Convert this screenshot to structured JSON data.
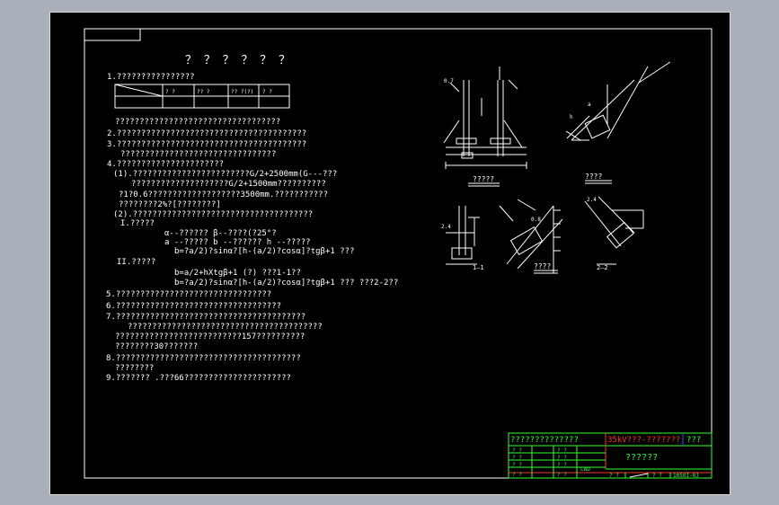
{
  "sheet": {
    "title": "？ ？ ？ ？ ？ ？"
  },
  "notes": [
    "1.????????????????",
    "??????????????????????????????????",
    "2.???????????????????????????????????????",
    "3.???????????????????????????????????????",
    "????????????????????????????????",
    "4.??????????????????????",
    "(1).????????????????????????G/2+2500mm(G---???",
    "????????????????????G/2+1500mm??????????",
    "?1?0.6???????????????????3500mm.???????????",
    "????????2%?[????????]",
    "(2).?????????????????????????????????????",
    "I.?????",
    "α--??????      β--????(?25°?",
    "a --?????        b --??????          h --?????",
    "b=?a/2)?sinα?[h-(a/2)?cosα]?tgβ+1          ???",
    "II.?????",
    "b=a/2+hXtgβ+1          (?)              ???1-1??",
    "b=?a/2)?sinα?[h-(a/2)?cosα]?tgβ+1      ???          ???2-2??",
    "5.????????????????????????????????",
    "6.??????????????????????????????????",
    "7.???????????????????????????????????????",
    "????????????????????????????????????????",
    "??????????????????????????157??????????",
    "????????30???????",
    "8.??????????????????????????????????????",
    "????????",
    "9.???????  .???66??????????????????????"
  ],
  "mini_table": {
    "headers": [
      "",
      "?  ?",
      "?? ?",
      "?? ?(?)",
      "? ?"
    ],
    "row": [
      "",
      "",
      "",
      "",
      ""
    ]
  },
  "figure_labels": {
    "fig_a": "?????",
    "fig_b": "????",
    "fig_c": "????",
    "fig_d": "1—1",
    "fig_e": "2—2"
  },
  "title_block": {
    "company": "??????????????",
    "project": "35kV???-???????",
    "stage": "???",
    "drawing_name": "??????",
    "cad_label": "CAD",
    "drawing_number": "1050I-0J",
    "row_labels": [
      "? ?",
      "? ?",
      "? ?",
      "? ?"
    ],
    "row_labels_right": [
      "? ?",
      "? ?",
      "? ?",
      "? ?"
    ],
    "footer": [
      "? ?",
      "? ?",
      "? ?"
    ]
  }
}
